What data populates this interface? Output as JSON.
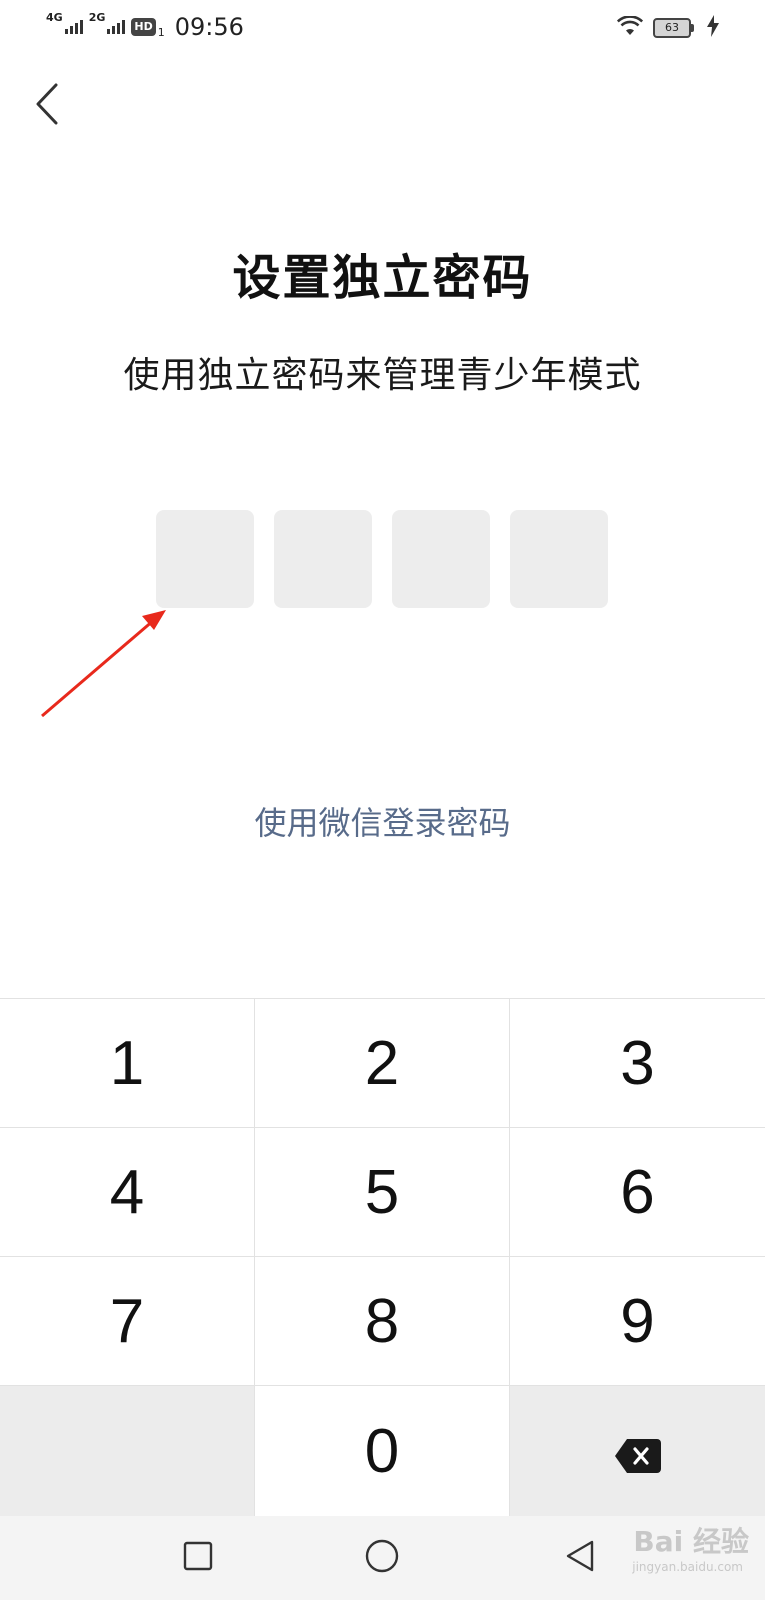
{
  "status_bar": {
    "network1": "4G",
    "network2": "2G",
    "hd_label": "HD",
    "hd_sub": "1",
    "time": "09:56",
    "battery_level": "63",
    "icons": [
      "signal-icon",
      "signal-icon",
      "hd-volte-icon",
      "wifi-icon",
      "battery-icon",
      "charging-icon"
    ]
  },
  "header": {
    "back_icon": "chevron-left-icon"
  },
  "main": {
    "title": "设置独立密码",
    "subtitle": "使用独立密码来管理青少年模式",
    "pin_length": 4,
    "alt_link": "使用微信登录密码"
  },
  "annotation": {
    "arrow_color": "#e8291c"
  },
  "keypad": {
    "keys": [
      "1",
      "2",
      "3",
      "4",
      "5",
      "6",
      "7",
      "8",
      "9",
      "",
      "0",
      "delete"
    ],
    "delete_icon": "backspace-icon"
  },
  "nav_bar": {
    "icons": [
      "square-recent-icon",
      "circle-home-icon",
      "triangle-back-icon"
    ]
  },
  "watermark": {
    "text": "Bai 经验",
    "sub": "jingyan.baidu.com"
  },
  "colors": {
    "link": "#586b8a",
    "pin_box": "#ededed",
    "keypad_gray": "#ececec"
  }
}
